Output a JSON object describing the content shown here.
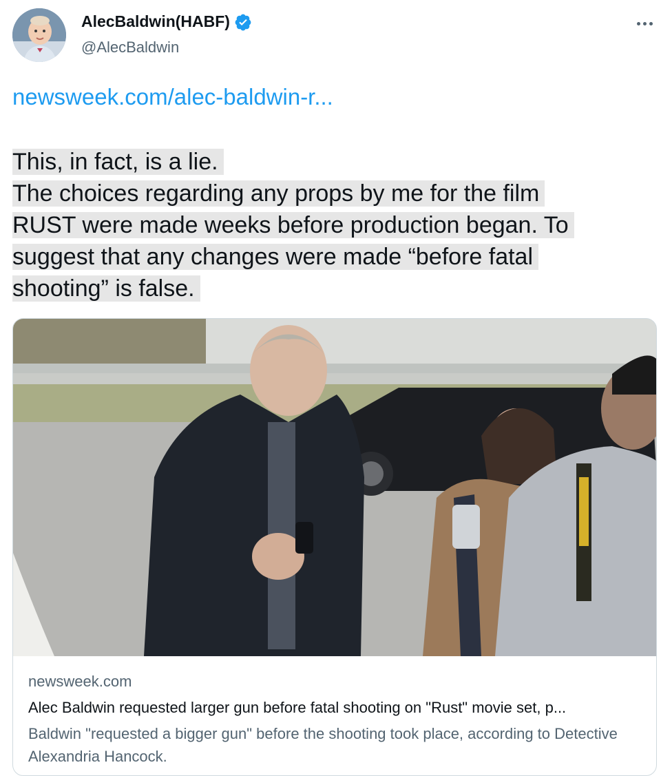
{
  "author": {
    "display_name": "AlecBaldwin(HABF)",
    "handle": "@AlecBaldwin",
    "verified": true,
    "avatar_icon": "avatar-baby-photo"
  },
  "tweet": {
    "link": "newsweek.com/alec-baldwin-r...",
    "lines": [
      "This, in fact, is a lie.",
      "The choices regarding any props by me for the film",
      "RUST were made weeks before production began. To",
      "suggest that any changes were made “before fatal",
      "shooting” is false."
    ]
  },
  "card": {
    "domain": "newsweek.com",
    "title": "Alec Baldwin requested larger gun before fatal shooting on \"Rust\" movie set, p...",
    "description": "Baldwin \"requested a bigger gun\" before the shooting took place, according to Detective Alexandria Hancock.",
    "image_icon": "news-photo"
  },
  "colors": {
    "link": "#1d9bf0",
    "text": "#0f1419",
    "muted": "#536471",
    "highlight": "#e6e6e6",
    "border": "#cfd9de"
  }
}
